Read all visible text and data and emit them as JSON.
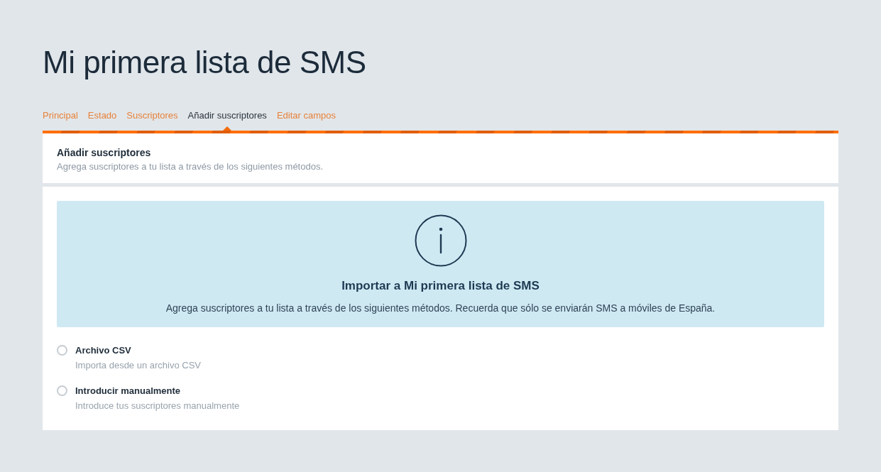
{
  "page_title": "Mi primera lista de SMS",
  "tabs": [
    {
      "label": "Principal",
      "selected": false
    },
    {
      "label": "Estado",
      "selected": false
    },
    {
      "label": "Suscriptores",
      "selected": false
    },
    {
      "label": "Añadir suscriptores",
      "selected": true
    },
    {
      "label": "Editar campos",
      "selected": false
    }
  ],
  "section": {
    "title": "Añadir suscriptores",
    "subtitle": "Agrega suscriptores a tu lista a través de los siguientes métodos."
  },
  "info_box": {
    "title": "Importar a Mi primera lista de SMS",
    "text": "Agrega suscriptores a tu lista a través de los siguientes métodos. Recuerda que sólo se enviarán SMS a móviles de España."
  },
  "options": [
    {
      "label": "Archivo CSV",
      "description": "Importa desde un archivo CSV",
      "selected": false
    },
    {
      "label": "Introducir manualmente",
      "description": "Introduce tus suscriptores manualmente",
      "selected": false
    }
  ]
}
